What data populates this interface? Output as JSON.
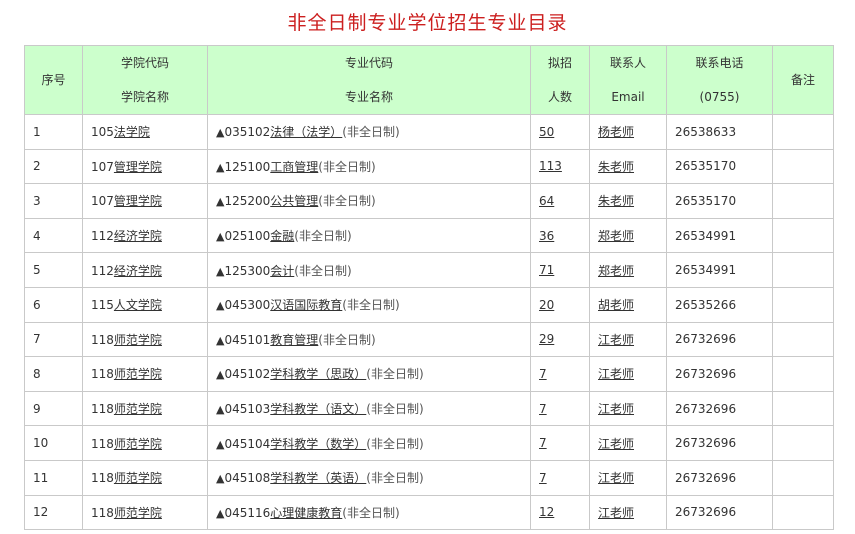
{
  "page": {
    "title": "非全日制专业学位招生专业目录"
  },
  "table": {
    "headers": {
      "seq": "序号",
      "college_line1": "学院代码",
      "college_line2": "学院名称",
      "major_line1": "专业代码",
      "major_line2": "专业名称",
      "quota_line1": "拟招",
      "quota_line2": "人数",
      "contact_line1": "联系人",
      "contact_line2": "Email",
      "phone_line1": "联系电话",
      "phone_line2": "(0755)",
      "remark": "备注"
    },
    "rows": [
      {
        "seq": "1",
        "college_code": "105",
        "college_name": "法学院",
        "marker": "▲",
        "major_code": "035102",
        "major_name": "法律（法学）",
        "mode": "(非全日制)",
        "quota": "50",
        "contact": "杨老师",
        "phone": "26538633",
        "remark": ""
      },
      {
        "seq": "2",
        "college_code": "107",
        "college_name": "管理学院",
        "marker": "▲",
        "major_code": "125100",
        "major_name": "工商管理",
        "mode": "(非全日制)",
        "quota": "113",
        "contact": "朱老师",
        "phone": "26535170",
        "remark": ""
      },
      {
        "seq": "3",
        "college_code": "107",
        "college_name": "管理学院",
        "marker": "▲",
        "major_code": "125200",
        "major_name": "公共管理",
        "mode": "(非全日制)",
        "quota": "64",
        "contact": "朱老师",
        "phone": "26535170",
        "remark": ""
      },
      {
        "seq": "4",
        "college_code": "112",
        "college_name": "经济学院",
        "marker": "▲",
        "major_code": "025100",
        "major_name": "金融",
        "mode": "(非全日制)",
        "quota": "36",
        "contact": "郑老师",
        "phone": "26534991",
        "remark": ""
      },
      {
        "seq": "5",
        "college_code": "112",
        "college_name": "经济学院",
        "marker": "▲",
        "major_code": "125300",
        "major_name": "会计",
        "mode": "(非全日制)",
        "quota": "71",
        "contact": "郑老师",
        "phone": "26534991",
        "remark": ""
      },
      {
        "seq": "6",
        "college_code": "115",
        "college_name": "人文学院",
        "marker": "▲",
        "major_code": "045300",
        "major_name": "汉语国际教育",
        "mode": "(非全日制)",
        "quota": "20",
        "contact": "胡老师",
        "phone": "26535266",
        "remark": ""
      },
      {
        "seq": "7",
        "college_code": "118",
        "college_name": "师范学院",
        "marker": "▲",
        "major_code": "045101",
        "major_name": "教育管理",
        "mode": "(非全日制)",
        "quota": "29",
        "contact": "江老师",
        "phone": "26732696",
        "remark": ""
      },
      {
        "seq": "8",
        "college_code": "118",
        "college_name": "师范学院",
        "marker": "▲",
        "major_code": "045102",
        "major_name": "学科教学（思政）",
        "mode": "(非全日制)",
        "quota": "7",
        "contact": "江老师",
        "phone": "26732696",
        "remark": ""
      },
      {
        "seq": "9",
        "college_code": "118",
        "college_name": "师范学院",
        "marker": "▲",
        "major_code": "045103",
        "major_name": "学科教学（语文）",
        "mode": "(非全日制)",
        "quota": "7",
        "contact": "江老师",
        "phone": "26732696",
        "remark": ""
      },
      {
        "seq": "10",
        "college_code": "118",
        "college_name": "师范学院",
        "marker": "▲",
        "major_code": "045104",
        "major_name": "学科教学（数学）",
        "mode": "(非全日制)",
        "quota": "7",
        "contact": "江老师",
        "phone": "26732696",
        "remark": ""
      },
      {
        "seq": "11",
        "college_code": "118",
        "college_name": "师范学院",
        "marker": "▲",
        "major_code": "045108",
        "major_name": "学科教学（英语）",
        "mode": "(非全日制)",
        "quota": "7",
        "contact": "江老师",
        "phone": "26732696",
        "remark": ""
      },
      {
        "seq": "12",
        "college_code": "118",
        "college_name": "师范学院",
        "marker": "▲",
        "major_code": "045116",
        "major_name": "心理健康教育",
        "mode": "(非全日制)",
        "quota": "12",
        "contact": "江老师",
        "phone": "26732696",
        "remark": ""
      }
    ]
  }
}
